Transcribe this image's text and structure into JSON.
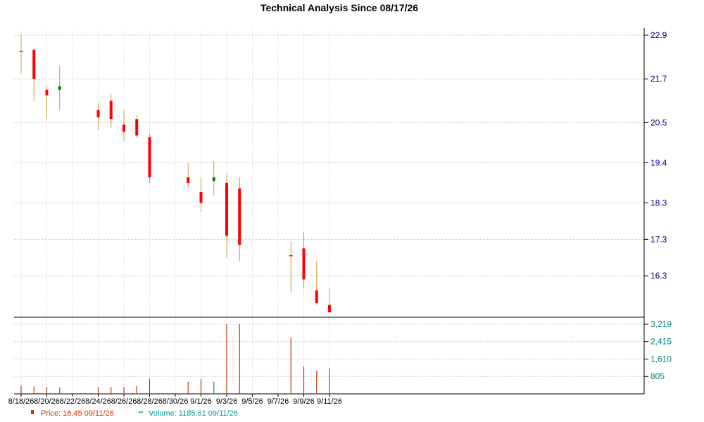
{
  "chart_data": {
    "type": "candlestick",
    "title": "Technical Analysis Since 08/17/26",
    "price_axis": {
      "ticks": [
        "16.3",
        "17.3",
        "18.3",
        "19.4",
        "20.5",
        "21.7",
        "22.9"
      ],
      "ylim": [
        15.3,
        22.9
      ]
    },
    "volume_axis": {
      "ticks": [
        "805",
        "1,610",
        "2,415",
        "3,219"
      ],
      "ylim": [
        0,
        3219
      ]
    },
    "x_tick_labels": [
      "8/18/26",
      "8/20/26",
      "8/22/26",
      "8/24/26",
      "8/26/26",
      "8/28/26",
      "8/30/26",
      "9/1/26",
      "9/3/26",
      "9/5/26",
      "9/7/26",
      "9/9/26",
      "9/11/26"
    ],
    "grid": true,
    "up_color": "#008000",
    "down_color": "#ff0000",
    "wick_color": "#cc9933",
    "volume_up_color": "#009966",
    "volume_down_color": "#cc3300",
    "candles": [
      {
        "date": "8/18/26",
        "open": 22.45,
        "high": 22.9,
        "low": 21.85,
        "close": 22.45,
        "volume": 380
      },
      {
        "date": "8/19/26",
        "open": 22.5,
        "high": 22.5,
        "low": 21.1,
        "close": 21.7,
        "volume": 350
      },
      {
        "date": "8/20/26",
        "open": 21.4,
        "high": 21.5,
        "low": 20.6,
        "close": 21.25,
        "volume": 320
      },
      {
        "date": "8/21/26",
        "open": 21.4,
        "high": 22.05,
        "low": 20.85,
        "close": 21.5,
        "volume": 310
      },
      {
        "date": "8/24/26",
        "open": 20.85,
        "high": 21.05,
        "low": 20.3,
        "close": 20.65,
        "volume": 320
      },
      {
        "date": "8/25/26",
        "open": 21.1,
        "high": 21.3,
        "low": 20.35,
        "close": 20.6,
        "volume": 320
      },
      {
        "date": "8/26/26",
        "open": 20.45,
        "high": 20.85,
        "low": 20.0,
        "close": 20.25,
        "volume": 320
      },
      {
        "date": "8/27/26",
        "open": 20.6,
        "high": 20.7,
        "low": 20.1,
        "close": 20.15,
        "volume": 360
      },
      {
        "date": "8/28/26",
        "open": 20.1,
        "high": 20.2,
        "low": 18.85,
        "close": 19.0,
        "volume": 690
      },
      {
        "date": "8/31/26",
        "open": 19.0,
        "high": 19.4,
        "low": 18.7,
        "close": 18.85,
        "volume": 560
      },
      {
        "date": "9/1/26",
        "open": 18.6,
        "high": 19.0,
        "low": 18.05,
        "close": 18.3,
        "volume": 680
      },
      {
        "date": "9/2/26",
        "open": 18.9,
        "high": 19.45,
        "low": 18.5,
        "close": 19.0,
        "volume": 570
      },
      {
        "date": "9/3/26",
        "open": 18.85,
        "high": 19.1,
        "low": 16.8,
        "close": 17.4,
        "volume": 3219
      },
      {
        "date": "9/4/26",
        "open": 18.7,
        "high": 19.0,
        "low": 16.7,
        "close": 17.15,
        "volume": 3219
      },
      {
        "date": "9/8/26",
        "open": 16.85,
        "high": 17.25,
        "low": 15.85,
        "close": 16.85,
        "volume": 2600
      },
      {
        "date": "9/9/26",
        "open": 17.05,
        "high": 17.5,
        "low": 15.95,
        "close": 16.2,
        "volume": 1270
      },
      {
        "date": "9/10/26",
        "open": 15.9,
        "high": 16.7,
        "low": 15.5,
        "close": 15.55,
        "volume": 1070
      },
      {
        "date": "9/11/26",
        "open": 15.5,
        "high": 15.95,
        "low": 15.3,
        "close": 15.3,
        "volume": 1185.61
      }
    ],
    "legend": {
      "price_text": "Price: 16.45  09/11/26",
      "volume_text": "Volume: 1185.61  09/11/26",
      "placement": "bottom-left"
    }
  }
}
